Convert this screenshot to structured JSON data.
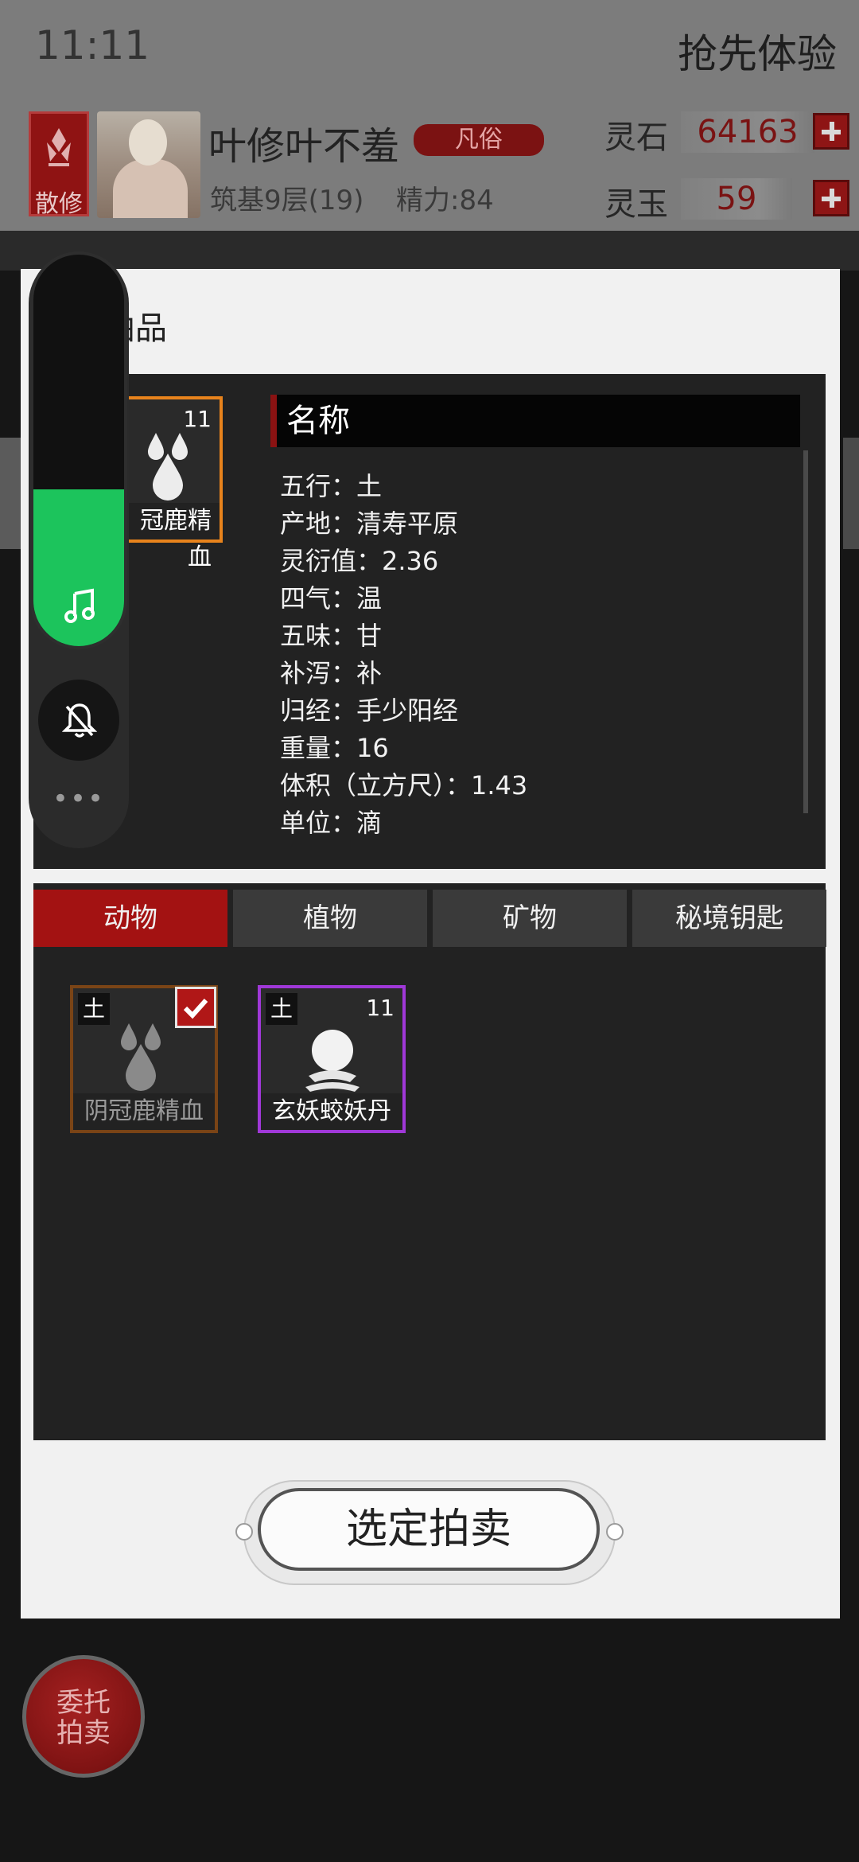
{
  "status": {
    "time": "11:11",
    "early_access": "抢先体验"
  },
  "player": {
    "badge": "散修",
    "name": "叶修叶不羞",
    "rank": "凡俗",
    "realm": "筑基9层(19)",
    "energy": "精力:84"
  },
  "currency": [
    {
      "label": "灵石",
      "value": "64163"
    },
    {
      "label": "灵玉",
      "value": "59"
    }
  ],
  "modal": {
    "title": "拍品",
    "selected": {
      "name": "阴冠鹿精血",
      "count": "11",
      "visible_name": "冠鹿精血"
    },
    "detail": {
      "name_header": "名称",
      "props": [
        "五行：土",
        "产地：清寿平原",
        "灵衍值：2.36",
        "四气：温",
        "五味：甘",
        "补泻：补",
        "归经：手少阳经",
        "重量：16",
        "体积（立方尺）：1.43",
        "单位：滴"
      ]
    },
    "tabs": [
      "动物",
      "植物",
      "矿物",
      "秘境钥匙"
    ],
    "active_tab": "动物",
    "items": [
      {
        "name": "阴冠鹿精血",
        "element": "土",
        "selected": true,
        "frame_color": "#7a4416",
        "icon": "blood-drops-icon"
      },
      {
        "name": "玄妖蛟妖丹",
        "element": "土",
        "count": "11",
        "selected": false,
        "frame_color": "#a038d8",
        "icon": "orb-icon"
      }
    ],
    "action_button": "选定拍卖"
  },
  "bottom": {
    "entrust_line1": "委托",
    "entrust_line2": "拍卖"
  },
  "volume": {
    "level": 0.4,
    "accent": "#1cc45c"
  },
  "colors": {
    "accent_red": "#a31212",
    "selected_frame": "#e8831c"
  }
}
